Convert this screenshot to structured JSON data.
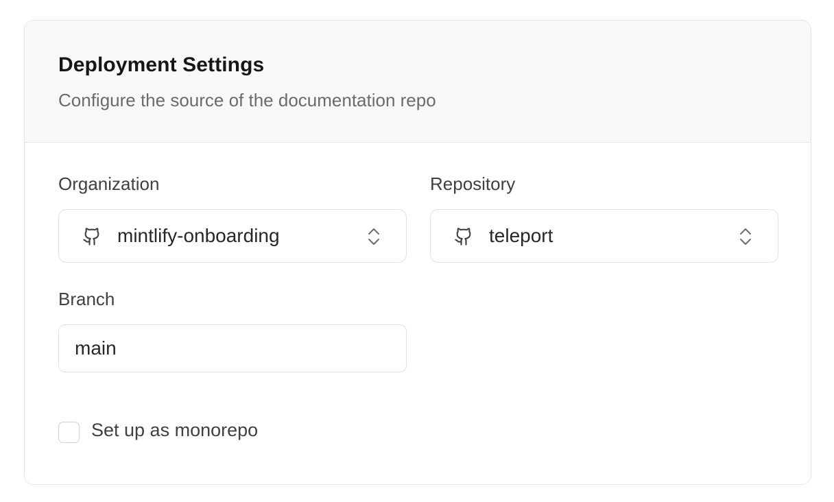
{
  "header": {
    "title": "Deployment Settings",
    "subtitle": "Configure the source of the documentation repo"
  },
  "organization": {
    "label": "Organization",
    "value": "mintlify-onboarding",
    "icon": "github-icon"
  },
  "repository": {
    "label": "Repository",
    "value": "teleport",
    "icon": "github-icon"
  },
  "branch": {
    "label": "Branch",
    "value": "main"
  },
  "monorepo": {
    "label": "Set up as monorepo",
    "checked": false
  }
}
